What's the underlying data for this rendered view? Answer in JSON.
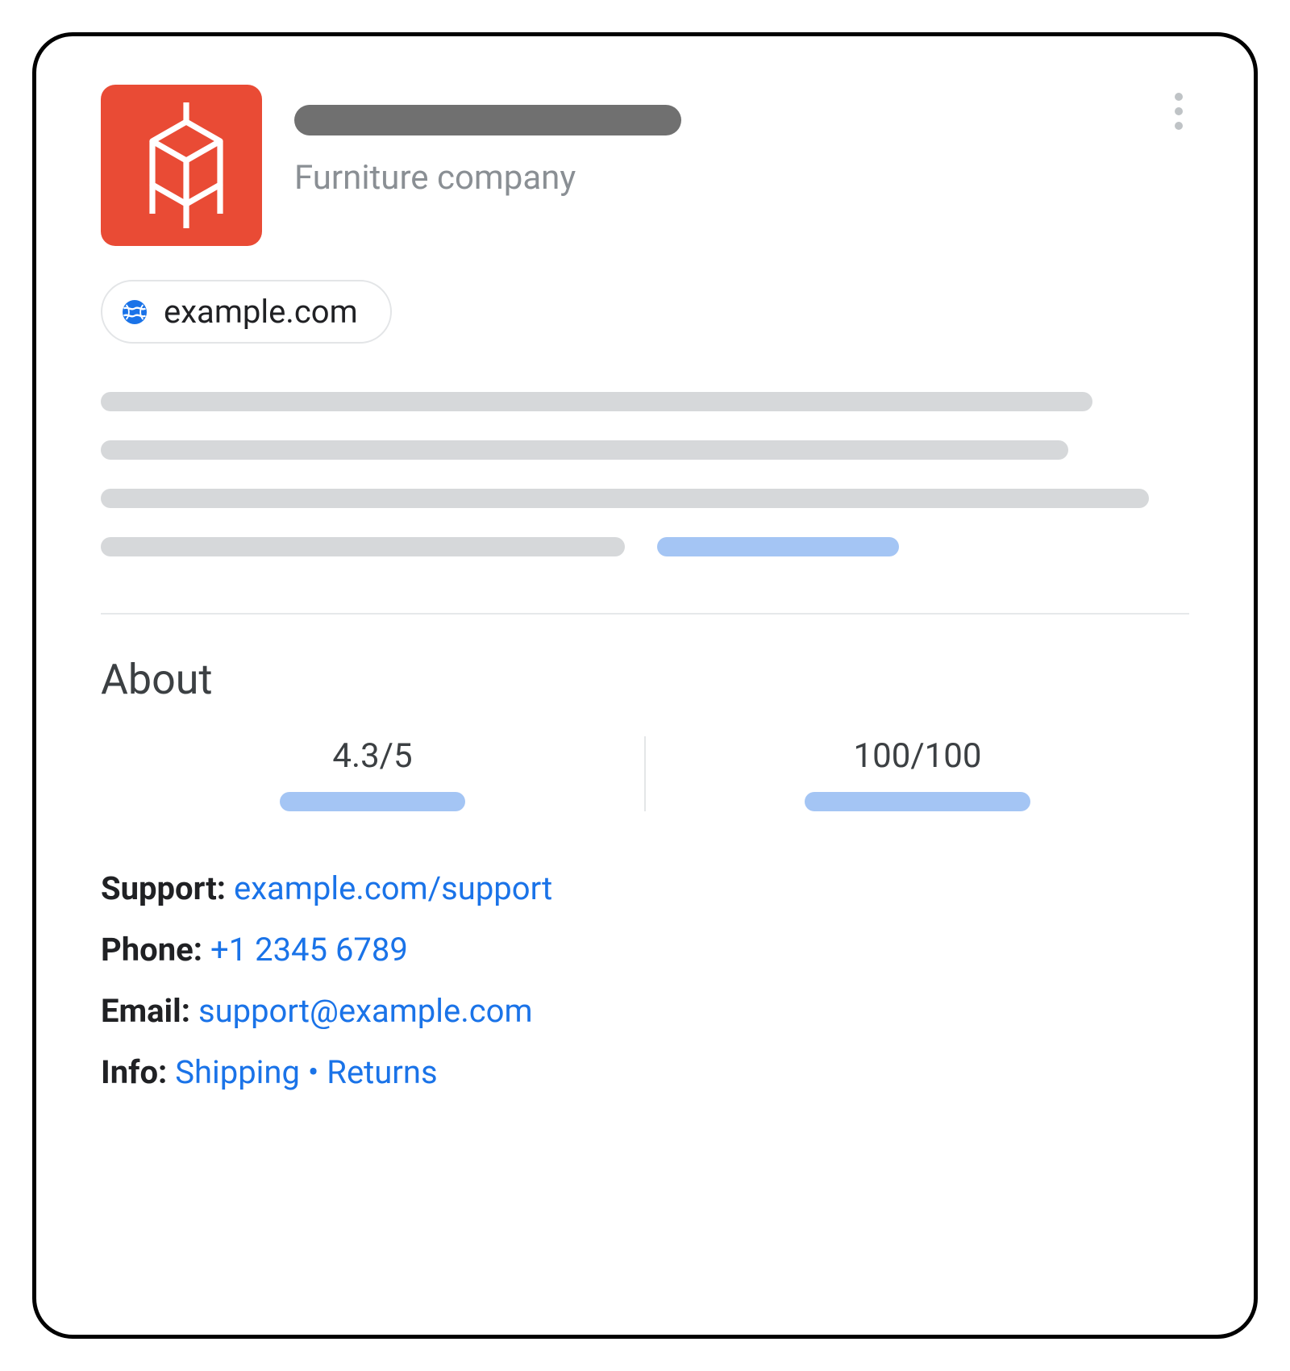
{
  "header": {
    "subtitle": "Furniture company",
    "website_chip": "example.com"
  },
  "about": {
    "heading": "About",
    "metric_left": "4.3/5",
    "metric_right": "100/100"
  },
  "contact": {
    "support_label": "Support: ",
    "support_link": "example.com/support",
    "phone_label": "Phone: ",
    "phone_link": "+1 2345 6789",
    "email_label": "Email: ",
    "email_link": "support@example.com",
    "info_label": "Info: ",
    "info_shipping": "Shipping",
    "info_sep": " • ",
    "info_returns": "Returns"
  }
}
